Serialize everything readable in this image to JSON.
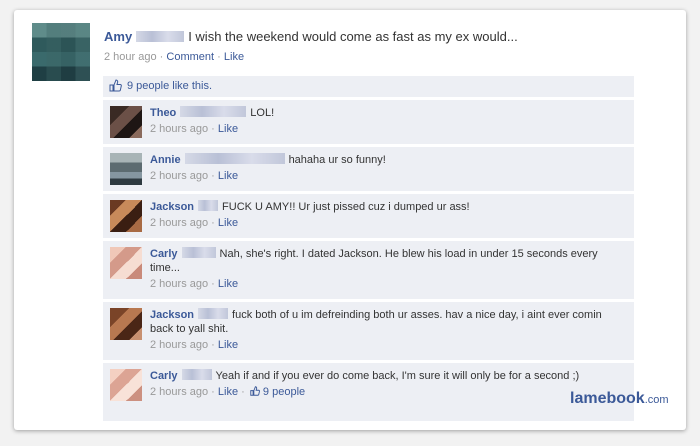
{
  "post": {
    "author": "Amy",
    "text": "I wish the weekend would come as fast as my ex would...",
    "time": "2 hour ago",
    "sep1": "·",
    "comment_label": "Comment",
    "sep2": "·",
    "like_label": "Like"
  },
  "likes_bar": {
    "text": "9 people like this."
  },
  "comments": [
    {
      "name": "Theo",
      "text": "LOL!",
      "time": "2 hours ago",
      "like": "Like"
    },
    {
      "name": "Annie",
      "text": "hahaha ur so funny!",
      "time": "2 hours ago",
      "like": "Like"
    },
    {
      "name": "Jackson",
      "text": "FUCK U AMY!! Ur just pissed cuz i dumped ur ass!",
      "time": "2 hours ago",
      "like": "Like"
    },
    {
      "name": "Carly",
      "text": "Nah, she's right. I dated Jackson. He blew his load in under 15 seconds every time...",
      "time": "2 hours ago",
      "like": "Like"
    },
    {
      "name": "Jackson",
      "text": "fuck both of u im defreinding both ur asses. hav a nice day, i aint ever comin back to yall shit.",
      "time": "2 hours ago",
      "like": "Like"
    },
    {
      "name": "Carly",
      "text": "Yeah if and if you ever do come back, I'm sure it will only be for a second ;)",
      "time": "2 hours ago",
      "like": "Like",
      "likes": "9 people"
    }
  ],
  "watermark": {
    "brand": "lamebook",
    "tld": ".com"
  },
  "colors": {
    "link": "#3b5998",
    "comment_bg": "#edeff4",
    "meta": "#999999"
  }
}
